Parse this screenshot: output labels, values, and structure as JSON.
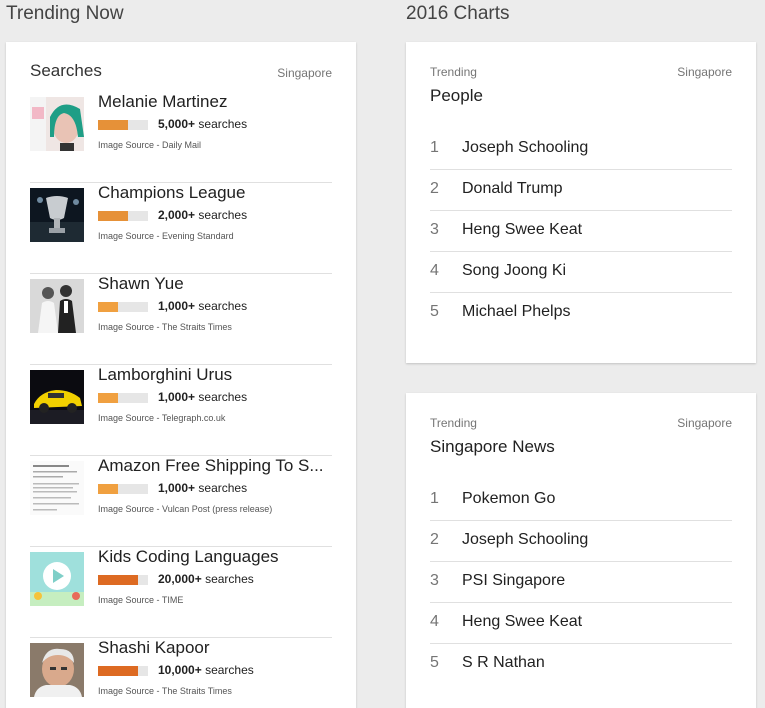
{
  "headers": {
    "left": "Trending Now",
    "right": "2016 Charts"
  },
  "searches": {
    "title": "Searches",
    "region": "Singapore",
    "items": [
      {
        "name": "Melanie Martinez",
        "count": "5,000+",
        "unit": "searches",
        "source": "Image Source - Daily Mail",
        "level": 0.6,
        "bar_color": "#e69138",
        "thumb": "portrait-photo"
      },
      {
        "name": "Champions League",
        "count": "2,000+",
        "unit": "searches",
        "source": "Image Source - Evening Standard",
        "level": 0.6,
        "bar_color": "#e69138",
        "thumb": "trophy-photo"
      },
      {
        "name": "Shawn Yue",
        "count": "1,000+",
        "unit": "searches",
        "source": "Image Source - The Straits Times",
        "level": 0.4,
        "bar_color": "#f0a040",
        "thumb": "wedding-photo"
      },
      {
        "name": "Lamborghini Urus",
        "count": "1,000+",
        "unit": "searches",
        "source": "Image Source - Telegraph.co.uk",
        "level": 0.4,
        "bar_color": "#f0a040",
        "thumb": "car-photo"
      },
      {
        "name": "Amazon Free Shipping To S...",
        "count": "1,000+",
        "unit": "searches",
        "source": "Image Source - Vulcan Post (press release)",
        "level": 0.4,
        "bar_color": "#f0a040",
        "thumb": "document-screenshot"
      },
      {
        "name": "Kids Coding Languages",
        "count": "20,000+",
        "unit": "searches",
        "source": "Image Source - TIME",
        "level": 0.8,
        "bar_color": "#dd6a22",
        "thumb": "play-illustration"
      },
      {
        "name": "Shashi Kapoor",
        "count": "10,000+",
        "unit": "searches",
        "source": "Image Source - The Straits Times",
        "level": 0.8,
        "bar_color": "#dd6a22",
        "thumb": "man-photo"
      }
    ]
  },
  "people_chart": {
    "label": "Trending",
    "region": "Singapore",
    "title": "People",
    "items": [
      {
        "rank": "1",
        "name": "Joseph Schooling"
      },
      {
        "rank": "2",
        "name": "Donald Trump"
      },
      {
        "rank": "3",
        "name": "Heng Swee Keat"
      },
      {
        "rank": "4",
        "name": "Song Joong Ki"
      },
      {
        "rank": "5",
        "name": "Michael Phelps"
      }
    ]
  },
  "news_chart": {
    "label": "Trending",
    "region": "Singapore",
    "title": "Singapore News",
    "items": [
      {
        "rank": "1",
        "name": "Pokemon Go"
      },
      {
        "rank": "2",
        "name": "Joseph Schooling"
      },
      {
        "rank": "3",
        "name": "PSI Singapore"
      },
      {
        "rank": "4",
        "name": "Heng Swee Keat"
      },
      {
        "rank": "5",
        "name": "S R Nathan"
      }
    ]
  }
}
